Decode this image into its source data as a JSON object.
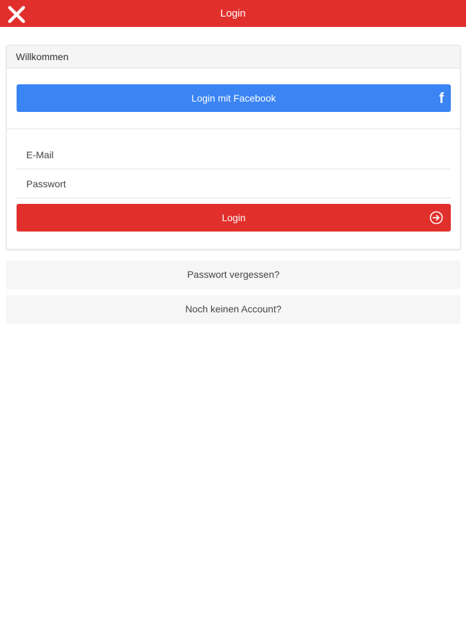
{
  "topbar": {
    "title": "Login",
    "close_icon": "close-icon",
    "background": "#e1302c"
  },
  "card": {
    "header": "Willkommen",
    "facebook_button": {
      "label": "Login mit Facebook",
      "icon": "f",
      "color": "#3a84f4"
    },
    "email_field": {
      "placeholder": "E-Mail",
      "value": ""
    },
    "password_field": {
      "placeholder": "Passwort",
      "value": ""
    },
    "login_button": {
      "label": "Login",
      "icon": "sign-in-icon",
      "color": "#e1302c"
    }
  },
  "links": {
    "forgot_password": "Passwort vergessen?",
    "no_account": "Noch keinen Account?"
  }
}
